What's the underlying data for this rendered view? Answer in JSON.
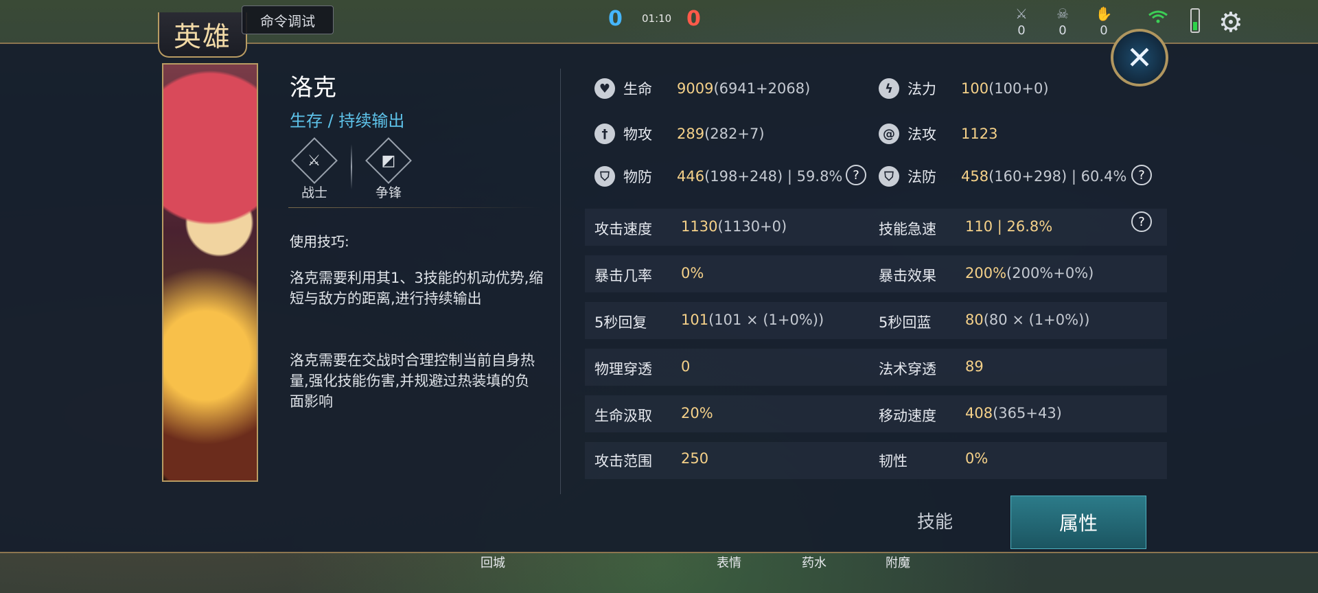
{
  "hud": {
    "score_blue": "0",
    "score_red": "0",
    "timer": "01:10",
    "stats": [
      {
        "icon": "swords-icon",
        "value": "0"
      },
      {
        "icon": "skull-icon",
        "value": "0"
      },
      {
        "icon": "assist-hand-icon",
        "value": "0"
      }
    ]
  },
  "panel": {
    "title": "英雄",
    "command_button": "命令调试",
    "close_symbol": "✕"
  },
  "hero": {
    "name": "洛克",
    "role": "生存 / 持续输出",
    "badges": [
      {
        "icon": "warrior-icon",
        "label": "战士"
      },
      {
        "icon": "contest-icon",
        "label": "争锋"
      }
    ],
    "tips_heading": "使用技巧:",
    "tips": [
      "洛克需要利用其1、3技能的机动优势,缩短与敌方的距离,进行持续输出",
      "洛克需要在交战时合理控制当前自身热量,强化技能伤害,并规避过热装填的负面影响"
    ]
  },
  "stats": {
    "hp": {
      "label": "生命",
      "total": "9009",
      "detail": "(6941+2068)"
    },
    "mana": {
      "label": "法力",
      "total": "100",
      "detail": "(100+0)"
    },
    "phys_atk": {
      "label": "物攻",
      "total": "289",
      "detail": "(282+7)"
    },
    "magic_atk": {
      "label": "法攻",
      "total": "1123",
      "detail": ""
    },
    "phys_def": {
      "label": "物防",
      "total": "446",
      "detail": "(198+248) | 59.8%"
    },
    "magic_def": {
      "label": "法防",
      "total": "458",
      "detail": "(160+298) | 60.4%"
    },
    "help_symbol": "?"
  },
  "attributes": [
    {
      "left_label": "攻击速度",
      "left_total": "1130",
      "left_detail": "(1130+0)",
      "right_label": "技能急速",
      "right_total": "110 | 26.8%",
      "right_detail": ""
    },
    {
      "left_label": "暴击几率",
      "left_total": "0%",
      "left_detail": "",
      "right_label": "暴击效果",
      "right_total": "200%",
      "right_detail": "(200%+0%)"
    },
    {
      "left_label": "5秒回复",
      "left_total": "101",
      "left_detail": "(101 × (1+0%))",
      "right_label": "5秒回蓝",
      "right_total": "80",
      "right_detail": "(80 × (1+0%))"
    },
    {
      "left_label": "物理穿透",
      "left_total": "0",
      "left_detail": "",
      "right_label": "法术穿透",
      "right_total": "89",
      "right_detail": ""
    },
    {
      "left_label": "生命汲取",
      "left_total": "20%",
      "left_detail": "",
      "right_label": "移动速度",
      "right_total": "408",
      "right_detail": "(365+43)"
    },
    {
      "left_label": "攻击范围",
      "left_total": "250",
      "left_detail": "",
      "right_label": "韧性",
      "right_total": "0%",
      "right_detail": ""
    }
  ],
  "tabs": {
    "skills": "技能",
    "attributes": "属性"
  },
  "bottom_bar": {
    "recall": "回城",
    "emote": "表情",
    "potion": "药水",
    "enchant": "附魔"
  }
}
